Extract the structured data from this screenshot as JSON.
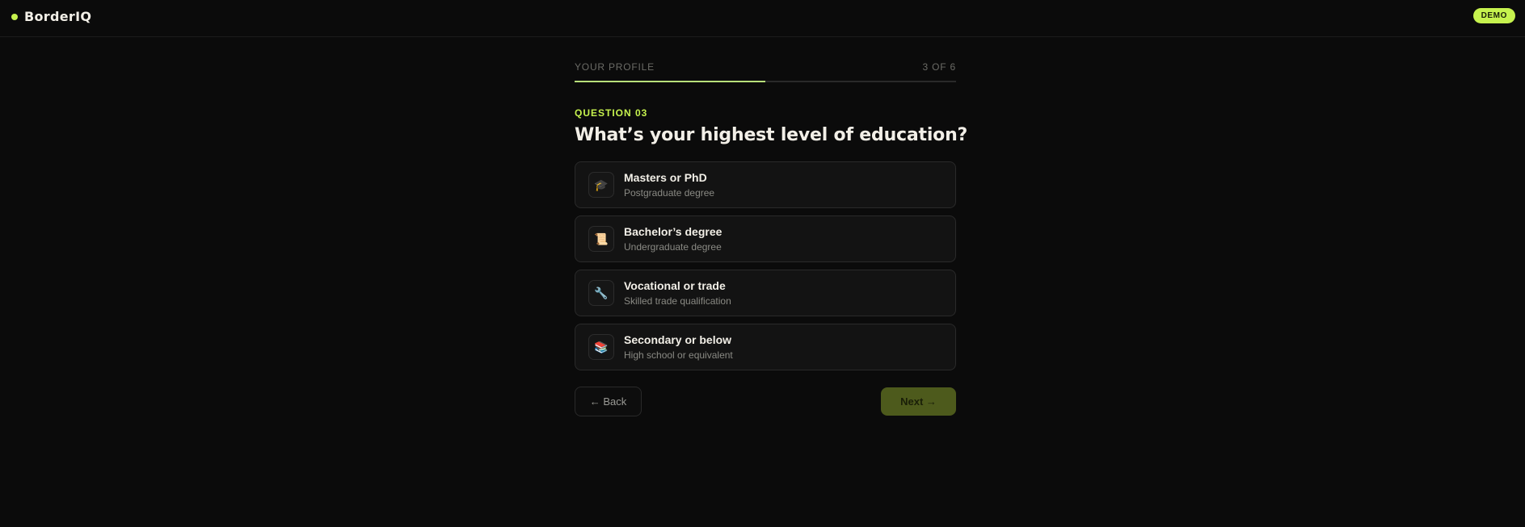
{
  "header": {
    "brand": "BorderIQ",
    "badge": "DEMO"
  },
  "progress": {
    "label": "YOUR PROFILE",
    "count": "3 OF 6",
    "fraction": 0.5
  },
  "question": {
    "label": "QUESTION 03",
    "title": "What’s your highest level of education?"
  },
  "options": [
    {
      "icon": "graduation-cap-icon",
      "glyph": "🎓",
      "title": "Masters or PhD",
      "subtitle": "Postgraduate degree"
    },
    {
      "icon": "scroll-icon",
      "glyph": "📜",
      "title": "Bachelor’s degree",
      "subtitle": "Undergraduate degree"
    },
    {
      "icon": "wrench-icon",
      "glyph": "🔧",
      "title": "Vocational or trade",
      "subtitle": "Skilled trade qualification"
    },
    {
      "icon": "books-icon",
      "glyph": "📚",
      "title": "Secondary or below",
      "subtitle": "High school or equivalent"
    }
  ],
  "nav": {
    "back_label": "← Back",
    "next_label": "Next →"
  },
  "colors": {
    "accent": "#c6f24e",
    "background": "#0b0b0b"
  }
}
